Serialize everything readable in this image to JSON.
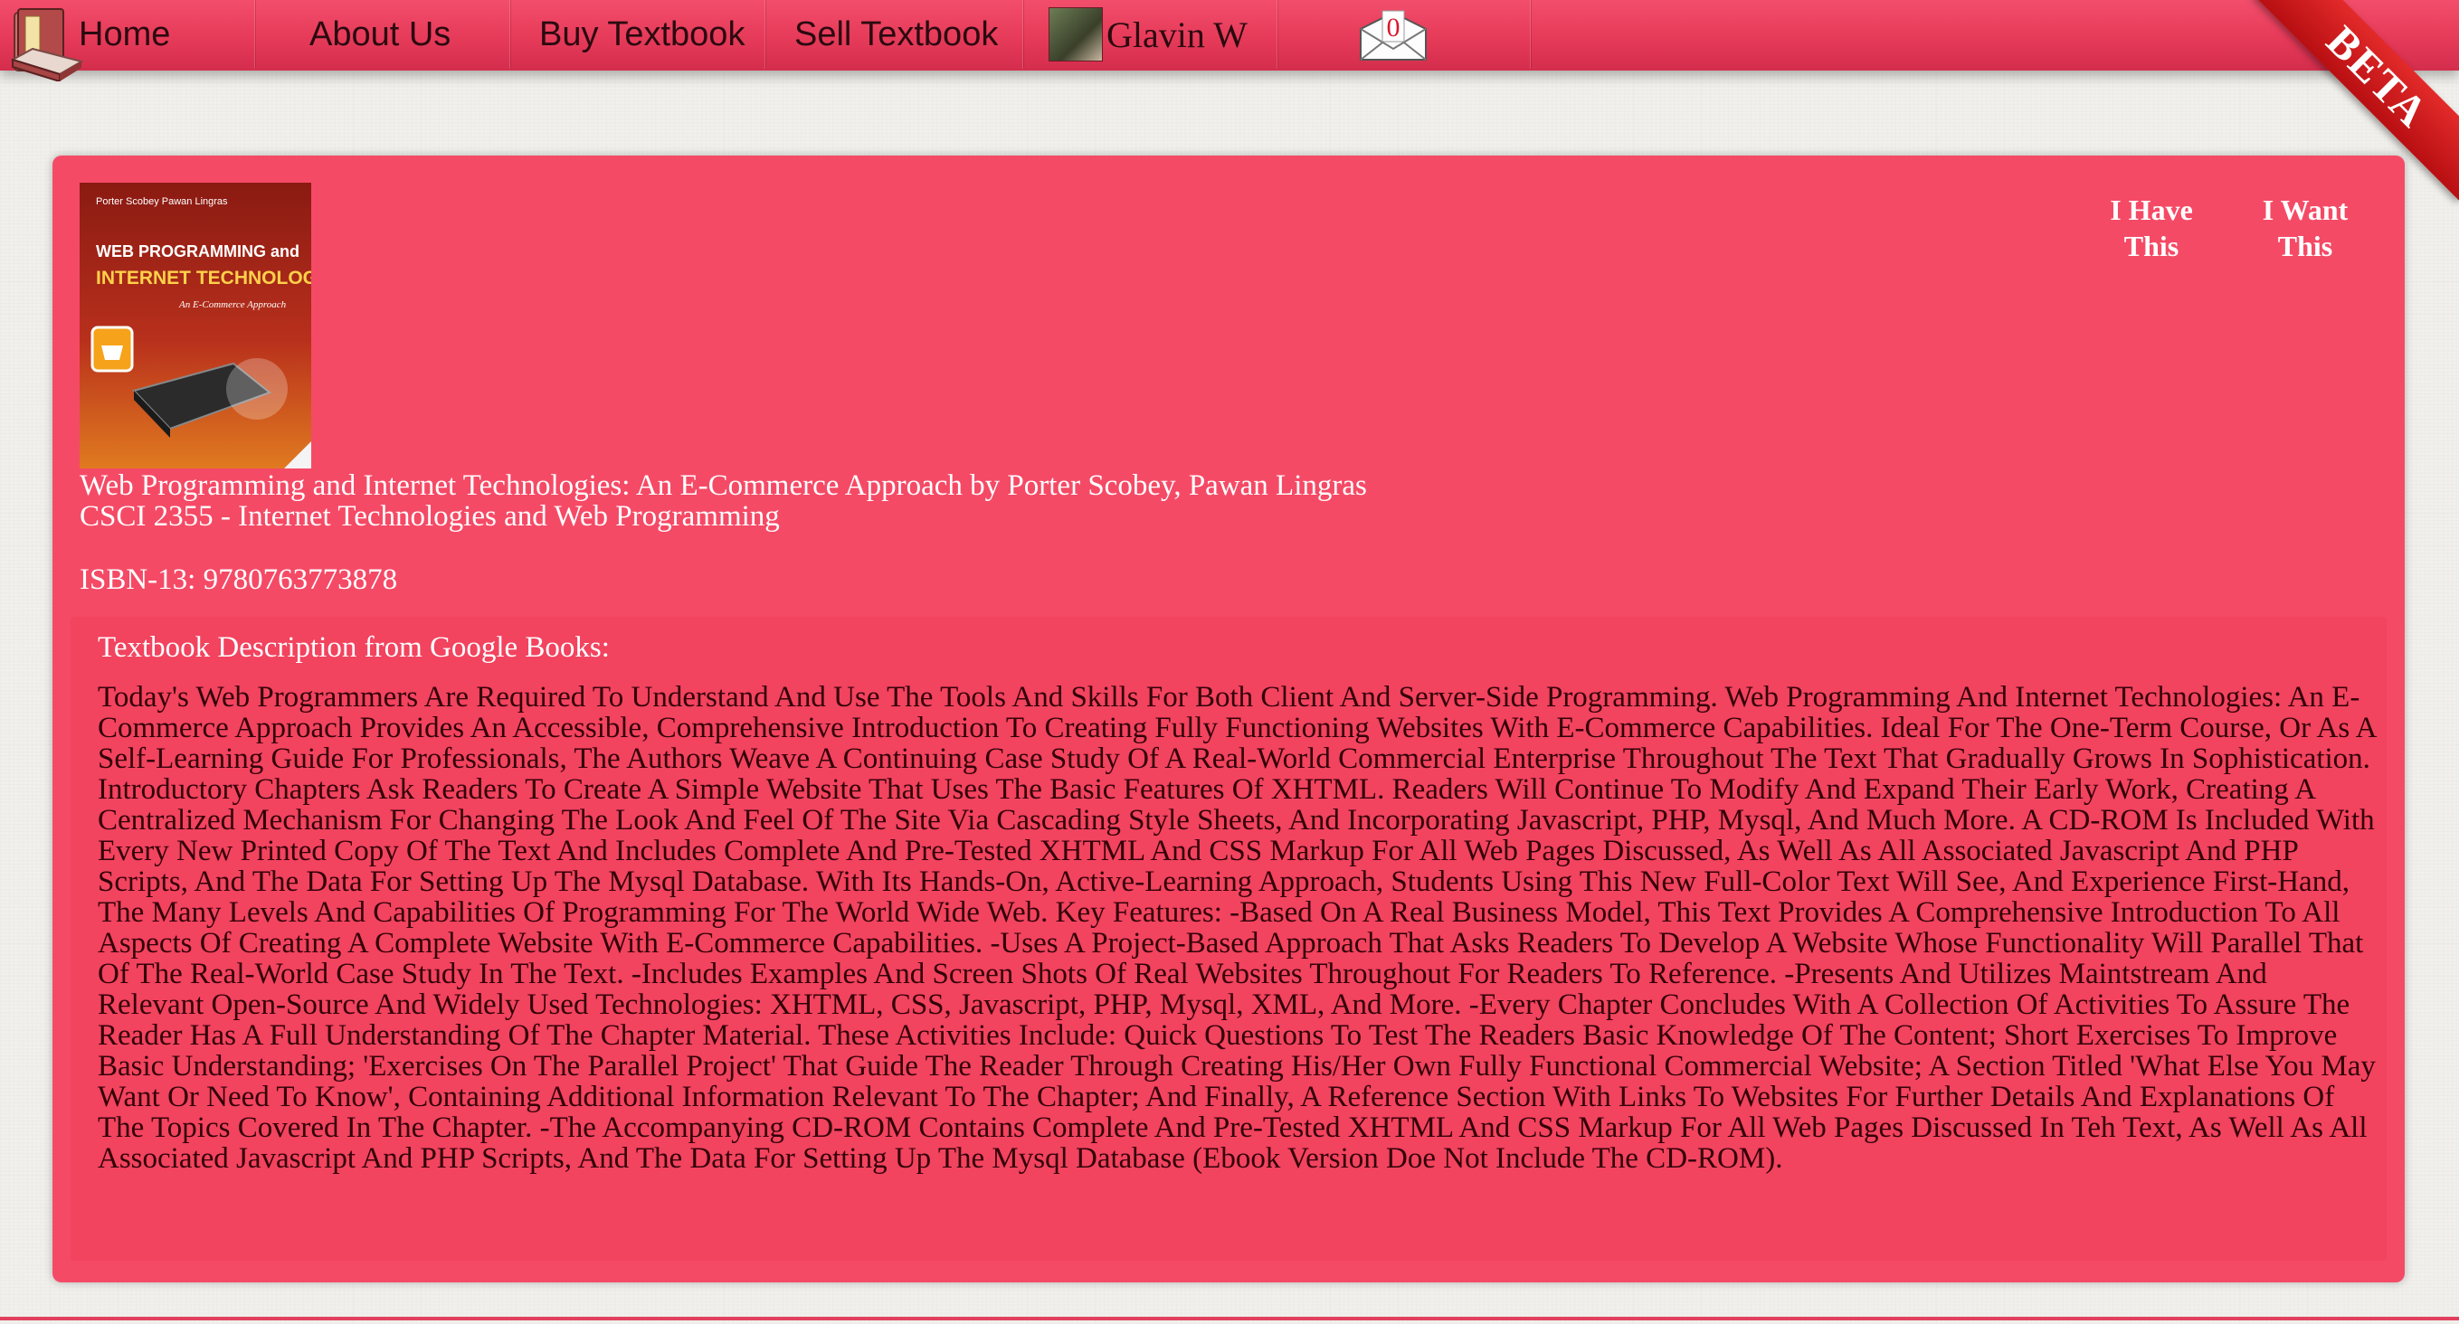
{
  "nav": {
    "home_label": "Home",
    "about_label": "About Us",
    "buy_label": "Buy Textbook",
    "sell_label": "Sell Textbook",
    "user_name": "Glavin W",
    "mail_count": "0"
  },
  "ribbon": {
    "label": "BETA"
  },
  "book": {
    "cover_title_line1": "WEB PROGRAMMING and",
    "cover_title_line2": "INTERNET TECHNOLOGIES",
    "cover_subtitle": "An E-Commerce Approach",
    "cover_authors": "Porter Scobey Pawan Lingras",
    "title_line": "Web Programming and Internet Technologies: An E-Commerce Approach by Porter Scobey, Pawan Lingras",
    "course_line": "CSCI 2355 - Internet Technologies and Web Programming",
    "isbn_line": "ISBN-13: 9780763773878"
  },
  "actions": {
    "have_label": "I Have This",
    "want_label": "I Want This"
  },
  "description": {
    "heading": "Textbook Description from Google Books:",
    "body": "Today's Web Programmers Are Required To Understand And Use The Tools And Skills For Both Client And Server-Side Programming. Web Programming And Internet Technologies: An E-Commerce Approach Provides An Accessible, Comprehensive Introduction To Creating Fully Functioning Websites With E-Commerce Capabilities. Ideal For The One-Term Course, Or As A Self-Learning Guide For Professionals, The Authors Weave A Continuing Case Study Of A Real-World Commercial Enterprise Throughout The Text That Gradually Grows In Sophistication. Introductory Chapters Ask Readers To Create A Simple Website That Uses The Basic Features Of XHTML. Readers Will Continue To Modify And Expand Their Early Work, Creating A Centralized Mechanism For Changing The Look And Feel Of The Site Via Cascading Style Sheets, And Incorporating Javascript, PHP, Mysql, And Much More. A CD-ROM Is Included With Every New Printed Copy Of The Text And Includes Complete And Pre-Tested XHTML And CSS Markup For All Web Pages Discussed, As Well As All Associated Javascript And PHP Scripts, And The Data For Setting Up The Mysql Database. With Its Hands-On, Active-Learning Approach, Students Using This New Full-Color Text Will See, And Experience First-Hand, The Many Levels And Capabilities Of Programming For The World Wide Web. Key Features: -Based On A Real Business Model, This Text Provides A Comprehensive Introduction To All Aspects Of Creating A Complete Website With E-Commerce Capabilities. -Uses A Project-Based Approach That Asks Readers To Develop A Website Whose Functionality Will Parallel That Of The Real-World Case Study In The Text. -Includes Examples And Screen Shots Of Real Websites Throughout For Readers To Reference. -Presents And Utilizes Maintstream And Relevant Open-Source And Widely Used Technologies: XHTML, CSS, Javascript, PHP, Mysql, XML, And More. -Every Chapter Concludes With A Collection Of Activities To Assure The Reader Has A Full Understanding Of The Chapter Material. These Activities Include: Quick Questions To Test The Readers Basic Knowledge Of The Content; Short Exercises To Improve Basic Understanding; 'Exercises On The Parallel Project' That Guide The Reader Through Creating His/Her Own Fully Functional Commercial Website; A Section Titled 'What Else You May Want Or Need To Know', Containing Additional Information Relevant To The Chapter; And Finally, A Reference Section With Links To Websites For Further Details And Explanations Of The Topics Covered In The Chapter. -The Accompanying CD-ROM Contains Complete And Pre-Tested XHTML And CSS Markup For All Web Pages Discussed In Teh Text, As Well As All Associated Javascript And PHP Scripts, And The Data For Setting Up The Mysql Database (Ebook Version Doe Not Include The CD-ROM)."
  },
  "icons": {
    "logo": "book-logo-icon",
    "avatar": "user-avatar",
    "mail": "envelope-icon"
  },
  "colors": {
    "nav_bar": "#e63a59",
    "panel": "#f54a66",
    "ribbon": "#d11a1d",
    "body_text": "#330208"
  }
}
